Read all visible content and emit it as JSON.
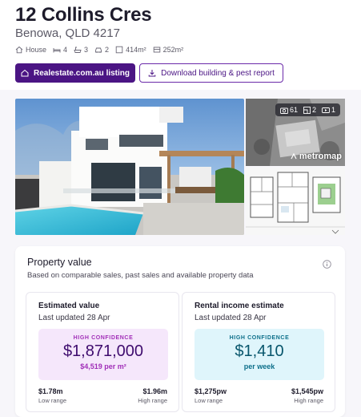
{
  "property": {
    "address": "12 Collins Cres",
    "suburb": "Benowa, QLD 4217",
    "features": [
      {
        "icon": "house-icon",
        "label": "House"
      },
      {
        "icon": "bed-icon",
        "label": "4"
      },
      {
        "icon": "bath-icon",
        "label": "3"
      },
      {
        "icon": "car-icon",
        "label": "2"
      },
      {
        "icon": "land-size-icon",
        "label": "414m²"
      },
      {
        "icon": "floor-area-icon",
        "label": "252m²"
      }
    ]
  },
  "actions": {
    "listing_label": "Realestate.com.au listing",
    "report_label": "Download building & pest report"
  },
  "gallery": {
    "photo_count": "61",
    "floorplan_count": "2",
    "video_count": "1",
    "aerial_provider": "metromap"
  },
  "property_value": {
    "title": "Property value",
    "subtitle": "Based on comparable sales, past sales and available property data",
    "estimate": {
      "title": "Estimated value",
      "updated": "Last updated 28 Apr",
      "confidence": "HIGH CONFIDENCE",
      "value": "$1,871,000",
      "per_m2": "$4,519 per m²",
      "low_value": "$1.78m",
      "low_label": "Low range",
      "high_value": "$1.96m",
      "high_label": "High range"
    },
    "rental": {
      "title": "Rental income estimate",
      "updated": "Last updated 28 Apr",
      "confidence": "HIGH CONFIDENCE",
      "value": "$1,410",
      "period": "per week",
      "low_value": "$1,275pw",
      "low_label": "Low range",
      "high_value": "$1,545pw",
      "high_label": "High range"
    }
  },
  "colors": {
    "brand": "#4b1584",
    "estimate_panel": "#f5e7fb",
    "rental_panel": "#dff5fb"
  }
}
